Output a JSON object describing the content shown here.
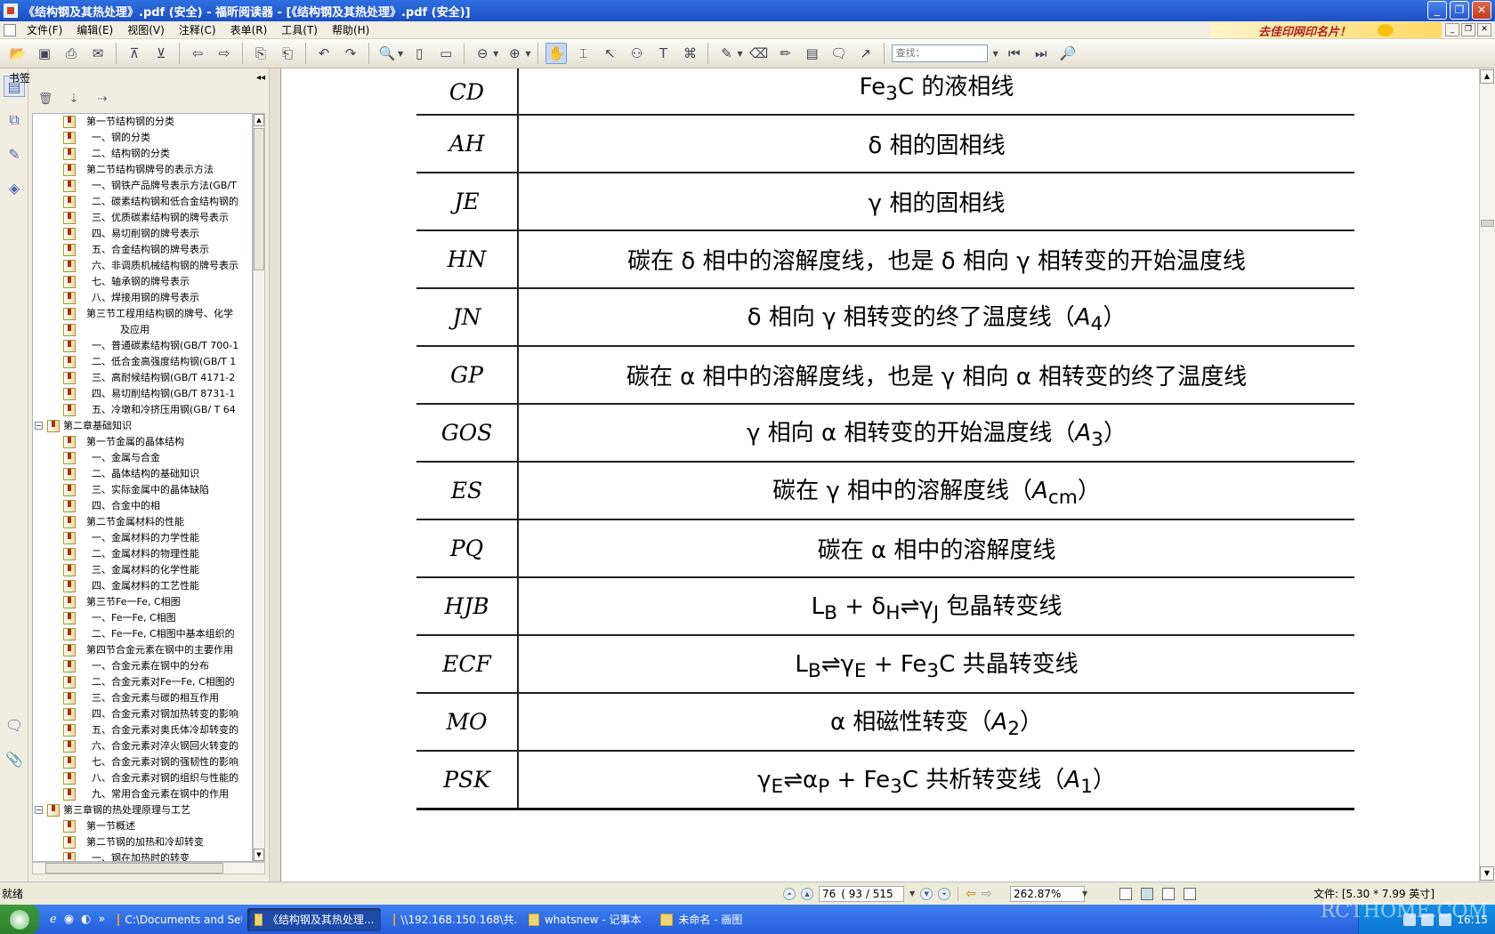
{
  "window": {
    "title": "《结构钢及其热处理》.pdf (安全) - 福昕阅读器 - [《结构钢及其热处理》.pdf (安全)]"
  },
  "menu": [
    "文件(F)",
    "编辑(E)",
    "视图(V)",
    "注释(C)",
    "表单(R)",
    "工具(T)",
    "帮助(H)"
  ],
  "ad": {
    "text": "去佳印网印名片！"
  },
  "toolbar": {
    "find_placeholder": "查找："
  },
  "sidebar": {
    "title": "书签",
    "tree": [
      {
        "level": 2,
        "label": "第一节结构钢的分类"
      },
      {
        "level": 3,
        "label": "一、钢的分类"
      },
      {
        "level": 3,
        "label": "二、结构钢的分类"
      },
      {
        "level": 2,
        "label": "第二节结构钢牌号的表示方法"
      },
      {
        "level": 3,
        "label": "一、钢铁产品牌号表示方法(GB/T"
      },
      {
        "level": 3,
        "label": "二、碳素结构钢和低合金结构钢的"
      },
      {
        "level": 3,
        "label": "三、优质碳素结构钢的牌号表示"
      },
      {
        "level": 3,
        "label": "四、易切削钢的牌号表示"
      },
      {
        "level": 3,
        "label": "五、合金结构钢的牌号表示"
      },
      {
        "level": 3,
        "label": "六、非调质机械结构钢的牌号表示"
      },
      {
        "level": 3,
        "label": "七、轴承钢的牌号表示"
      },
      {
        "level": 3,
        "label": "八、焊接用钢的牌号表示"
      },
      {
        "level": 2,
        "label": "第三节工程用结构钢的牌号、化学"
      },
      {
        "level": 4,
        "label": "及应用",
        "nobk": true
      },
      {
        "level": 3,
        "label": "一、普通碳素结构钢(GB/T 700-1"
      },
      {
        "level": 3,
        "label": "二、低合金高强度结构钢(GB/T 1"
      },
      {
        "level": 3,
        "label": "三、高耐候结构钢(GB/T 4171-2"
      },
      {
        "level": 3,
        "label": "四、易切削结构钢(GB/T 8731-1"
      },
      {
        "level": 3,
        "label": "五、冷墩和冷挤压用钢(GB/ T 64"
      },
      {
        "level": 1,
        "label": "第二章基础知识",
        "expander": true
      },
      {
        "level": 2,
        "label": "第一节金属的晶体结构"
      },
      {
        "level": 3,
        "label": "一、金属与合金"
      },
      {
        "level": 3,
        "label": "二、晶体结构的基础知识"
      },
      {
        "level": 3,
        "label": "三、实际金属中的晶体缺陷"
      },
      {
        "level": 3,
        "label": "四、合金中的相"
      },
      {
        "level": 2,
        "label": "第二节金属材料的性能"
      },
      {
        "level": 3,
        "label": "一、金属材料的力学性能"
      },
      {
        "level": 3,
        "label": "二、金属材料的物理性能"
      },
      {
        "level": 3,
        "label": "三、金属材料的化学性能"
      },
      {
        "level": 3,
        "label": "四、金属材料的工艺性能"
      },
      {
        "level": 2,
        "label": "第三节Fe一Fe, C相图"
      },
      {
        "level": 3,
        "label": "一、Fe一Fe, C相图"
      },
      {
        "level": 3,
        "label": "二、Fe一Fe, C相图中基本组织的"
      },
      {
        "level": 2,
        "label": "第四节合金元素在钢中的主要作用"
      },
      {
        "level": 3,
        "label": "一、合金元素在钢中的分布"
      },
      {
        "level": 3,
        "label": "二、合金元素对Fe一Fe, C相图的"
      },
      {
        "level": 3,
        "label": "三、合金元素与碳的相互作用"
      },
      {
        "level": 3,
        "label": "四、合金元素对钢加热转变的影响"
      },
      {
        "level": 3,
        "label": "五、合金元素对奥氏体冷却转变的"
      },
      {
        "level": 3,
        "label": "六、合金元素对淬火钢回火转变的"
      },
      {
        "level": 3,
        "label": "七、合金元素对钢的强韧性的影响"
      },
      {
        "level": 3,
        "label": "八、合金元素对钢的组织与性能的"
      },
      {
        "level": 3,
        "label": "九、常用合金元素在钢中的作用"
      },
      {
        "level": 1,
        "label": "第三章钢的热处理原理与工艺",
        "expander": true
      },
      {
        "level": 2,
        "label": "第一节概述"
      },
      {
        "level": 2,
        "label": "第二节钢的加热和冷却转变"
      },
      {
        "level": 3,
        "label": "一、钢在加热时的转变"
      }
    ]
  },
  "document": {
    "rows": [
      {
        "code": "CD",
        "html": "Fe<sub>3</sub>C 的液相线"
      },
      {
        "code": "AH",
        "html": "δ 相的固相线"
      },
      {
        "code": "JE",
        "html": "γ 相的固相线"
      },
      {
        "code": "HN",
        "html": "碳在 δ 相中的溶解度线，也是 δ 相向 γ 相转变的开始温度线"
      },
      {
        "code": "JN",
        "html": "δ 相向 γ 相转变的终了温度线（<i>A</i><sub>4</sub>）"
      },
      {
        "code": "GP",
        "html": "碳在 α 相中的溶解度线，也是 γ 相向 α 相转变的终了温度线"
      },
      {
        "code": "GOS",
        "html": "γ 相向 α 相转变的开始温度线（<i>A</i><sub>3</sub>）"
      },
      {
        "code": "ES",
        "html": "碳在 γ 相中的溶解度线（<i>A</i><sub>cm</sub>）"
      },
      {
        "code": "PQ",
        "html": "碳在 α 相中的溶解度线"
      },
      {
        "code": "HJB",
        "html": "L<sub>B</sub> + δ<sub>H</sub>⇌γ<sub>J</sub> 包晶转变线"
      },
      {
        "code": "ECF",
        "html": "L<sub>B</sub>⇌γ<sub>E</sub> + Fe<sub>3</sub>C 共晶转变线"
      },
      {
        "code": "MO",
        "html": "α 相磁性转变（<i>A</i><sub>2</sub>）"
      },
      {
        "code": "PSK",
        "html": "γ<sub>E</sub>⇌α<sub>P</sub> + Fe<sub>3</sub>C 共析转变线（<i>A</i><sub>1</sub>）"
      }
    ]
  },
  "status": {
    "ready": "就绪",
    "page": "76",
    "page_of": "( 93 / 515",
    "zoom": "262.87%",
    "file_info": "文件: [5.30 * 7.99 英寸]"
  },
  "taskbar": {
    "tasks": [
      {
        "label": "C:\\Documents and Set...",
        "active": false
      },
      {
        "label": "《结构钢及其热处理...",
        "active": true
      },
      {
        "label": "\\\\192.168.150.168\\共...",
        "active": false
      },
      {
        "label": "whatsnew - 记事本",
        "active": false
      },
      {
        "label": "未命名 - 画图",
        "active": false
      }
    ],
    "clock": "16:15",
    "watermark": "RCTHOME.COM"
  }
}
